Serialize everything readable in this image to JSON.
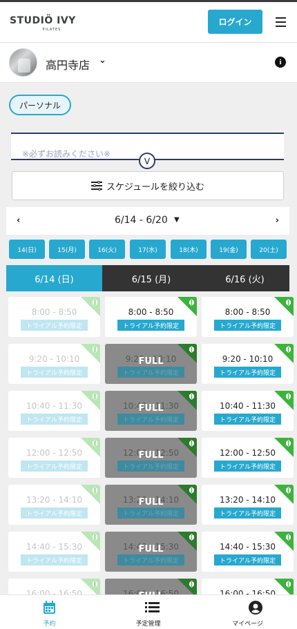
{
  "header": {
    "logo": "STUDIÖ IVY",
    "logo_sub": "PILATES",
    "login_label": "ログイン"
  },
  "store": {
    "name": "高円寺店"
  },
  "category": {
    "label": "パーソナル"
  },
  "notice": {
    "text": "※必ずお読みください※"
  },
  "filter": {
    "label": "スケジュールを絞り込む"
  },
  "week": {
    "label": "6/14 - 6/20"
  },
  "day_chips": [
    "14(日)",
    "15(月)",
    "16(火)",
    "17(水)",
    "18(木)",
    "19(金)",
    "20(土)"
  ],
  "columns": [
    "6/14 (日)",
    "6/15 (月)",
    "6/16 (火)"
  ],
  "colors": {
    "accent": "#27a8cf",
    "dark": "#333333",
    "trial_corner": "#3cb43c"
  },
  "slot_tag": "トライアル予約限定",
  "full_label": "FULL",
  "schedule": [
    [
      {
        "time": "8:00 - 8:50",
        "state": "past"
      },
      {
        "time": "9:20 - 10:10",
        "state": "past"
      },
      {
        "time": "10:40 - 11:30",
        "state": "past"
      },
      {
        "time": "12:00 - 12:50",
        "state": "past"
      },
      {
        "time": "13:20 - 14:10",
        "state": "past"
      },
      {
        "time": "14:40 - 15:30",
        "state": "past"
      },
      {
        "time": "16:00 - 16:50",
        "state": "past"
      }
    ],
    [
      {
        "time": "8:00 - 8:50",
        "state": "open"
      },
      {
        "time": "9:20 - 10:10",
        "state": "full"
      },
      {
        "time": "10:40 - 11:30",
        "state": "full"
      },
      {
        "time": "12:00 - 12:50",
        "state": "full"
      },
      {
        "time": "13:20 - 14:10",
        "state": "full"
      },
      {
        "time": "14:40 - 15:30",
        "state": "full"
      },
      {
        "time": "16:00 - 16:50",
        "state": "full"
      }
    ],
    [
      {
        "time": "8:00 - 8:50",
        "state": "open"
      },
      {
        "time": "9:20 - 10:10",
        "state": "open"
      },
      {
        "time": "10:40 - 11:30",
        "state": "open"
      },
      {
        "time": "12:00 - 12:50",
        "state": "open"
      },
      {
        "time": "13:20 - 14:10",
        "state": "open"
      },
      {
        "time": "14:40 - 15:30",
        "state": "open"
      },
      {
        "time": "16:00 - 16:50",
        "state": "open"
      }
    ]
  ],
  "tabs": [
    {
      "label": "予約",
      "icon": "calendar-icon",
      "active": true
    },
    {
      "label": "予定管理",
      "icon": "list-icon",
      "active": false
    },
    {
      "label": "マイページ",
      "icon": "user-icon",
      "active": false
    }
  ]
}
